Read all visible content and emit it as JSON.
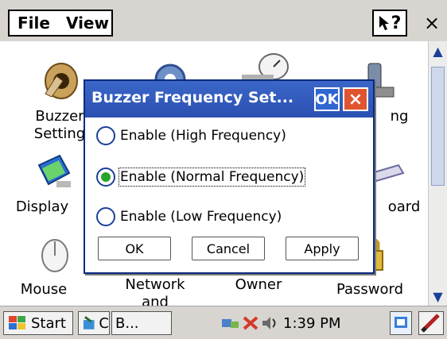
{
  "menubar": {
    "file": "File",
    "view": "View",
    "help_symbol": "?",
    "close_symbol": "×"
  },
  "icons": [
    {
      "label_lines": [
        "Buzzer",
        "Setting"
      ],
      "name": "buzzer-icon"
    },
    {
      "label_lines": [
        "ng"
      ],
      "name": "power-icon"
    },
    {
      "label_lines": [
        "Display"
      ],
      "name": "display-icon"
    },
    {
      "label_lines": [
        "oard"
      ],
      "name": "keyboard-icon"
    },
    {
      "label_lines": [
        "Mouse"
      ],
      "name": "mouse-icon"
    },
    {
      "label_lines": [
        "Network and"
      ],
      "name": "network-icon"
    },
    {
      "label_lines": [
        "Owner"
      ],
      "name": "owner-icon"
    },
    {
      "label_lines": [
        "Password"
      ],
      "name": "password-icon"
    }
  ],
  "dialog": {
    "title": "Buzzer Frequency Set...",
    "ok_box": "OK",
    "close_box": "×",
    "options": [
      {
        "label": "Enable (High Frequency)",
        "selected": false
      },
      {
        "label": "Enable (Normal Frequency)",
        "selected": true
      },
      {
        "label": "Enable (Low Frequency)",
        "selected": false
      }
    ],
    "buttons": {
      "ok": "OK",
      "cancel": "Cancel",
      "apply": "Apply"
    }
  },
  "taskbar": {
    "start": "Start",
    "task1": "C",
    "task2": "B...",
    "time": "1:39 PM"
  },
  "colors": {
    "title_bar": "#2a4fb1",
    "ok_box": "#2f66d2",
    "close_box": "#e0542f",
    "radio_selected": "#26a52a"
  }
}
